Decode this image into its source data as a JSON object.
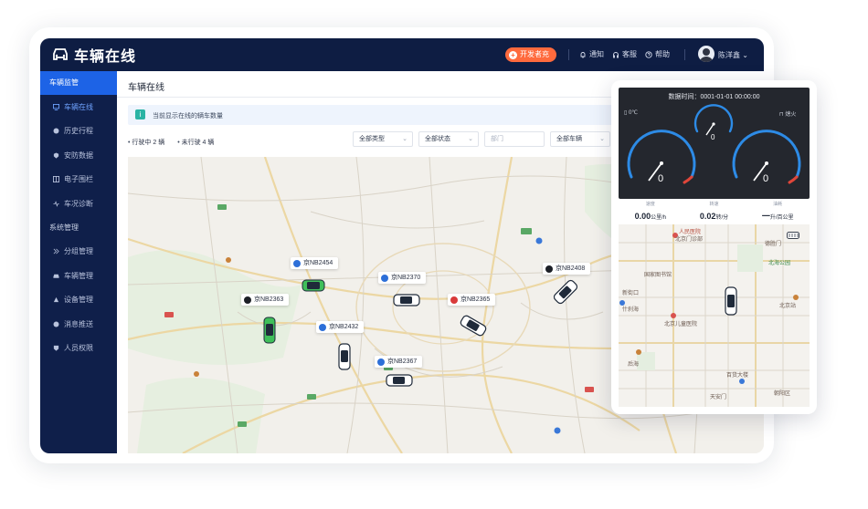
{
  "app": {
    "title": "车辆在线",
    "top_button": "开发者充",
    "top_links": [
      "通知",
      "客服",
      "帮助"
    ],
    "user_name": "陈洋鑫"
  },
  "sidebar": {
    "groups": [
      {
        "label": "车辆监管",
        "active": true,
        "items": [
          {
            "label": "车辆在线",
            "icon": "monitor-icon",
            "active": true
          },
          {
            "label": "历史行程",
            "icon": "history-icon",
            "active": false
          },
          {
            "label": "安防数据",
            "icon": "shield-icon",
            "active": false
          },
          {
            "label": "电子围栏",
            "icon": "fence-icon",
            "active": false
          },
          {
            "label": "车况诊断",
            "icon": "diagnose-icon",
            "active": false
          }
        ]
      },
      {
        "label": "系统管理",
        "active": false,
        "items": [
          {
            "label": "分组管理",
            "icon": "group-icon",
            "active": false
          },
          {
            "label": "车辆管理",
            "icon": "car-icon",
            "active": false
          },
          {
            "label": "设备管理",
            "icon": "device-icon",
            "active": false
          },
          {
            "label": "消息推送",
            "icon": "bell-icon",
            "active": false
          },
          {
            "label": "人员权限",
            "icon": "user-icon",
            "active": false
          }
        ]
      }
    ]
  },
  "main": {
    "page_title": "车辆在线",
    "info_text": "当前显示在线的辆车数量",
    "stats": [
      "行驶中 2 辆",
      "未行驶 4 辆"
    ],
    "filters": {
      "type": "全部类型",
      "status": "全部状态",
      "dept_placeholder": "部门",
      "vehicle": "全部车辆"
    }
  },
  "map": {
    "cars": [
      {
        "plate": "京NB2454",
        "badge": "brand",
        "color": "green"
      },
      {
        "plate": "京NB2363",
        "badge": "dark",
        "color": "green"
      },
      {
        "plate": "京NB2432",
        "badge": "brand",
        "color": "white"
      },
      {
        "plate": "京NB2370",
        "badge": "brand",
        "color": "white"
      },
      {
        "plate": "京NB2367",
        "badge": "brand",
        "color": "white"
      },
      {
        "plate": "京NB2365",
        "badge": "red",
        "color": "white"
      },
      {
        "plate": "京NB2408",
        "badge": "dark",
        "color": "white"
      }
    ]
  },
  "phone": {
    "data_time_label": "数据时间：",
    "data_time": "0001-01-01 00:00:00",
    "left_status": "0℃",
    "right_status": "熄火",
    "gauges": {
      "left_value": "0",
      "center_value": "0",
      "right_value": "0"
    },
    "stats": [
      {
        "label": "速度",
        "value": "0.00",
        "unit": "公里/h"
      },
      {
        "label": "转速",
        "value": "0.02",
        "unit": "转/分"
      },
      {
        "label": "油耗",
        "value": "一",
        "unit": "升/百公里"
      }
    ],
    "pois": [
      "人民医院",
      "北京门诊部",
      "德胜门",
      "北海公园",
      "国家图书馆",
      "北京站",
      "北京儿童医院",
      "后海",
      "百货大楼",
      "朝阳区",
      "什刹海",
      "新街口",
      "天安门"
    ]
  },
  "colors": {
    "nav_bg": "#0e1d43",
    "accent": "#1d63e6",
    "top_button": "#ff6a3d"
  }
}
